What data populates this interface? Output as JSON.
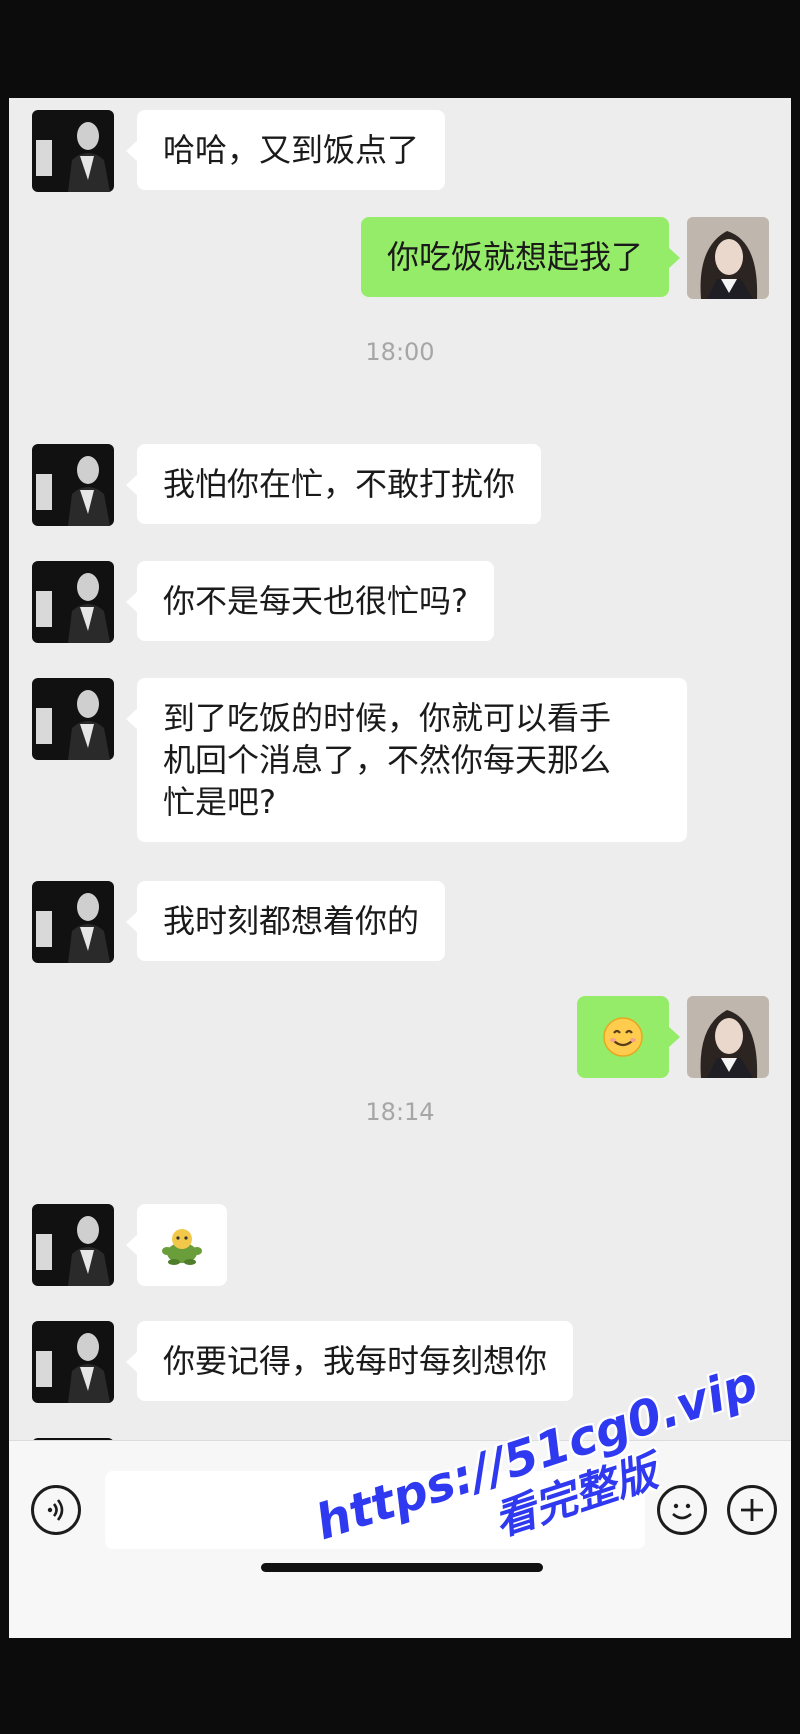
{
  "messages": [
    {
      "text": "哈哈，又到饭点了"
    },
    {
      "text": "你吃饭就想起我了"
    },
    {
      "text": "我怕你在忙，不敢打扰你"
    },
    {
      "text": "你不是每天也很忙吗?"
    },
    {
      "line1": "到了吃饭的时候，你就可以看手",
      "line2": "机回个消息了，不然你每天那么",
      "line3": "忙是吧?"
    },
    {
      "text": "我时刻都想着你的"
    },
    {
      "text": "你要记得，我每时每刻想你"
    }
  ],
  "timestamps": [
    "18:00",
    "18:14"
  ],
  "stickers": {
    "smile": "smile-emoji",
    "frog": "frog-emoji"
  },
  "colors": {
    "sent_bubble": "#95ec69",
    "received_bubble": "#ffffff",
    "background": "#ededed"
  },
  "watermark": {
    "url": "https://51cg0.vip",
    "text": "看完整版"
  }
}
